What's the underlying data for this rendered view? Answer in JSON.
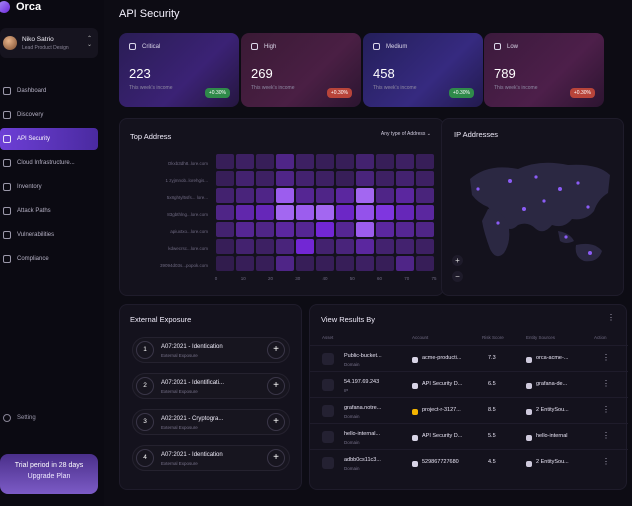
{
  "app": {
    "name": "Orca"
  },
  "user": {
    "name": "Niko Satrio",
    "role": "Lead Product Design"
  },
  "sidebar": {
    "items": [
      {
        "label": "Dashboard",
        "icon": "dashboard-icon",
        "active": false
      },
      {
        "label": "Discovery",
        "icon": "search-icon",
        "active": false
      },
      {
        "label": "API Security",
        "icon": "shield-icon",
        "active": true
      },
      {
        "label": "Cloud Infrastructure...",
        "icon": "cloud-icon",
        "active": false
      },
      {
        "label": "Inventory",
        "icon": "inventory-icon",
        "active": false
      },
      {
        "label": "Attack Paths",
        "icon": "path-icon",
        "active": false
      },
      {
        "label": "Vulnerabilities",
        "icon": "bug-icon",
        "active": false
      },
      {
        "label": "Compliance",
        "icon": "check-circle-icon",
        "active": false
      }
    ],
    "setting_label": "Setting",
    "trial_text": "Trial period in 28 days",
    "upgrade_label": "Upgrade Plan"
  },
  "page": {
    "title": "API Security"
  },
  "stats": [
    {
      "label": "Critical",
      "value": "223",
      "sub": "This week's income",
      "badge": "+0.30%",
      "trend": "up",
      "icon": "home-icon"
    },
    {
      "label": "High",
      "value": "269",
      "sub": "This week's income",
      "badge": "+0.30%",
      "trend": "down",
      "icon": "warning-icon"
    },
    {
      "label": "Medium",
      "value": "458",
      "sub": "This week's income",
      "badge": "+0.30%",
      "trend": "up",
      "icon": "info-icon"
    },
    {
      "label": "Low",
      "value": "789",
      "sub": "This week's income",
      "badge": "+0.30%",
      "trend": "down",
      "icon": "document-icon"
    }
  ],
  "top_address": {
    "title": "Top Address",
    "filter": "Any type of Address",
    "rows": [
      "Okxb3dh8..lore.com",
      "1 zyjmnob..lorehgis...",
      "5x8ghtyl5sfs... lore...",
      "83gbthlng...lore.com",
      "apiuxtxo...lore.com",
      "kdwecrsc...lore.com",
      "39094d03s...popok.com"
    ],
    "x_ticks": [
      "0",
      "10",
      "20",
      "30",
      "40",
      "50",
      "60",
      "70",
      "75"
    ],
    "intensity": [
      [
        0.1,
        0.15,
        0.1,
        0.3,
        0.15,
        0.1,
        0.1,
        0.2,
        0.1,
        0.15,
        0.1
      ],
      [
        0.1,
        0.2,
        0.15,
        0.3,
        0.2,
        0.15,
        0.1,
        0.25,
        0.15,
        0.2,
        0.15
      ],
      [
        0.2,
        0.25,
        0.3,
        0.9,
        0.35,
        0.3,
        0.4,
        0.95,
        0.3,
        0.4,
        0.25
      ],
      [
        0.3,
        0.45,
        0.5,
        0.95,
        0.9,
        0.95,
        0.55,
        0.85,
        0.7,
        0.5,
        0.4
      ],
      [
        0.2,
        0.35,
        0.3,
        0.4,
        0.35,
        0.6,
        0.35,
        0.9,
        0.4,
        0.35,
        0.3
      ],
      [
        0.1,
        0.2,
        0.15,
        0.25,
        0.6,
        0.2,
        0.25,
        0.4,
        0.2,
        0.2,
        0.15
      ],
      [
        0.05,
        0.1,
        0.1,
        0.3,
        0.1,
        0.1,
        0.1,
        0.15,
        0.1,
        0.3,
        0.1
      ]
    ]
  },
  "ip": {
    "title": "IP Addresses",
    "zoom_in": "+",
    "zoom_out": "−"
  },
  "external": {
    "title": "External Exposure",
    "items": [
      {
        "num": "1",
        "title": "A07:2021 - Identication",
        "sub": "External Exposure"
      },
      {
        "num": "2",
        "title": "A07:2021 - Identificati...",
        "sub": "External Exposure"
      },
      {
        "num": "3",
        "title": "A02:2021 - Cryptogra...",
        "sub": "External Exposure"
      },
      {
        "num": "4",
        "title": "A07:2021 - Identication",
        "sub": "External Exposure"
      }
    ]
  },
  "results": {
    "title": "View Results By",
    "headers": [
      "Asset",
      "Account",
      "Risk Score",
      "Entity Sources",
      "Action"
    ],
    "rows": [
      {
        "asset": "Public-bucket...",
        "type": "Domain",
        "account": "acme-producti...",
        "score": "7.3",
        "entity": "orca-acme-...",
        "asset_icon": "bucket-icon",
        "account_icon": "aws-icon",
        "entity_icon": "globe-icon"
      },
      {
        "asset": "54.197.69.243",
        "type": "IP",
        "account": "API Security D...",
        "score": "6.5",
        "entity": "grafana-de...",
        "asset_icon": "ip-icon",
        "account_icon": "aws-icon",
        "entity_icon": "monitor-icon"
      },
      {
        "asset": "grafana.notre...",
        "type": "Domain",
        "account": "project-r-3127...",
        "score": "8.5",
        "entity": "2 EntitySou...",
        "asset_icon": "bucket-icon",
        "account_icon": "gcp-icon",
        "entity_icon": "stack-icon"
      },
      {
        "asset": "hello-internal...",
        "type": "Domain",
        "account": "API Security D...",
        "score": "5.5",
        "entity": "hello-internal",
        "asset_icon": "bucket-icon",
        "account_icon": "aws-icon",
        "entity_icon": "monitor-icon"
      },
      {
        "asset": "adbb0cs11c3...",
        "type": "Domain",
        "account": "529867727680",
        "score": "4.5",
        "entity": "2 EntitySou...",
        "asset_icon": "bucket-icon",
        "account_icon": "aws-icon",
        "entity_icon": "stack-icon"
      }
    ]
  },
  "colors": {
    "accent": "#7c3aed",
    "up": "#2f8a4a",
    "down": "#b8443a"
  }
}
